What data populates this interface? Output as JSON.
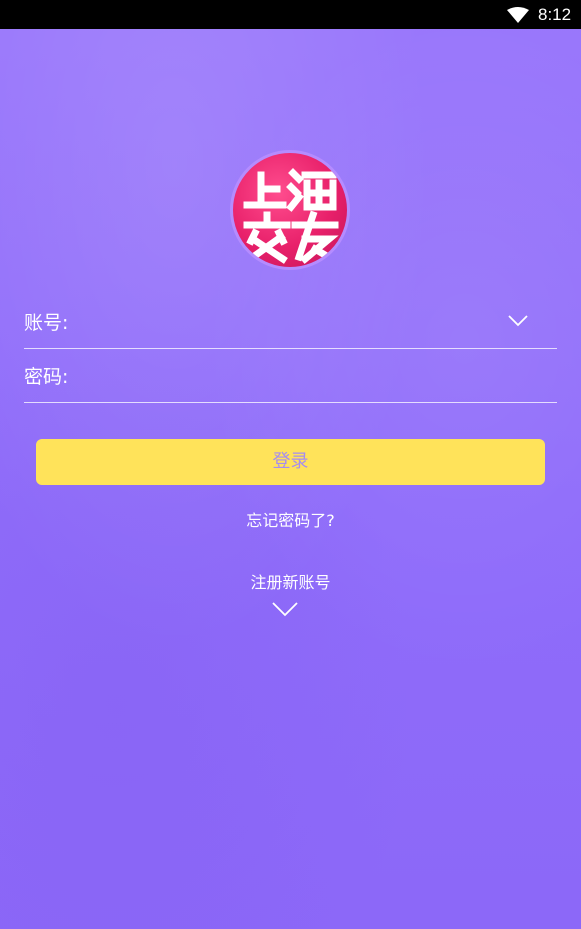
{
  "status_bar": {
    "time": "8:12",
    "wifi_icon": "wifi-icon"
  },
  "logo": {
    "icon": "app-logo-icon",
    "text": "上海交友",
    "colors": {
      "primary": "#e8206a",
      "ring": "#b58cff"
    }
  },
  "form": {
    "account_label": "账号:",
    "account_value": "",
    "account_dropdown_icon": "chevron-down-icon",
    "password_label": "密码:",
    "password_value": ""
  },
  "login_button": {
    "label": "登录",
    "background": "#ffe35a",
    "text_color": "#a68df0"
  },
  "links": {
    "forgot_password": "忘记密码了?",
    "register": "注册新账号",
    "register_icon": "chevron-down-icon"
  },
  "theme": {
    "background": "#9a78fb"
  }
}
